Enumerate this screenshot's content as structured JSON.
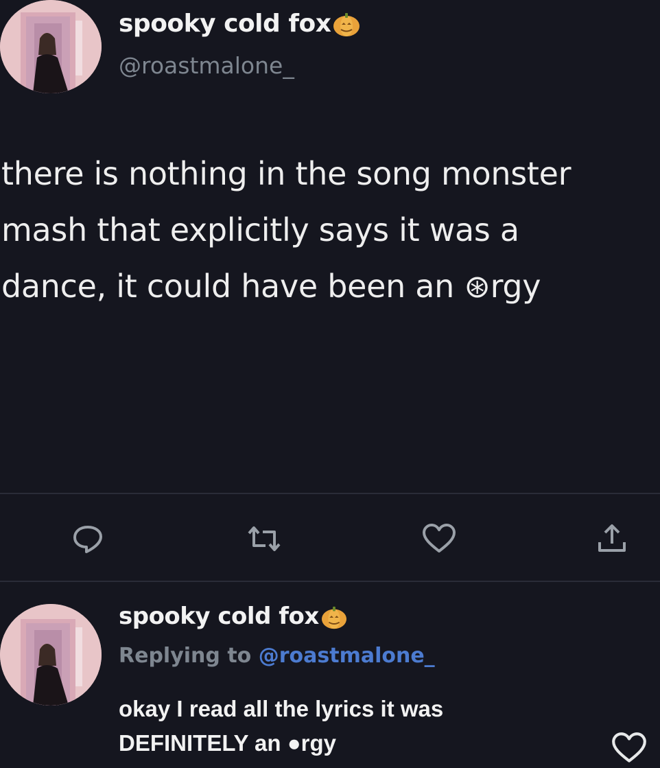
{
  "tweet": {
    "display_name": "spooky cold fox",
    "handle": "@roastmalone_",
    "badge_icon": "pumpkin-emoji",
    "text_lines": [
      "there is nothing in the song monster",
      "mash that explicitly says it was a",
      "dance, it could have been an ⊛rgy"
    ],
    "actions": [
      {
        "name": "reply",
        "icon": "speech-bubble-icon"
      },
      {
        "name": "retweet",
        "icon": "retweet-icon"
      },
      {
        "name": "like",
        "icon": "heart-icon"
      },
      {
        "name": "share",
        "icon": "share-icon"
      }
    ]
  },
  "reply": {
    "display_name": "spooky cold fox",
    "badge_icon": "pumpkin-emoji",
    "replying_prefix": "Replying to ",
    "replying_handle": "@roastmalone_",
    "text_lines": [
      "okay I read all the lyrics it was",
      "DEFINITELY an ●rgy"
    ],
    "like_icon": "heart-icon"
  },
  "colors": {
    "background": "#15161f",
    "text": "#eeeeee",
    "muted": "#7e8690",
    "link": "#4c7bd0"
  }
}
